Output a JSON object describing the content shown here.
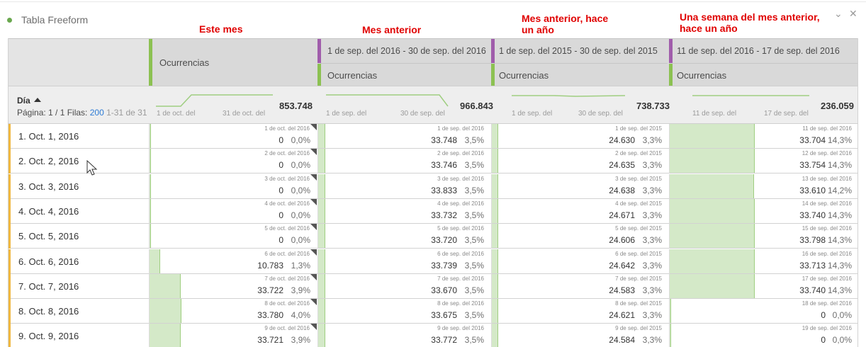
{
  "panel": {
    "title": "Tabla Freeform",
    "collapse_icon": "chevron-down-icon",
    "close_icon": "close-icon"
  },
  "annotations": [
    "Este mes",
    "Mes anterior",
    "Mes anterior, hace\nun año",
    "Una semana del mes anterior,\nhace un año"
  ],
  "header": {
    "col1_metric": "Ocurrencias",
    "col2_range": "1 de sep. del 2016 - 30 de sep. del 2016",
    "col2_metric": "Ocurrencias",
    "col3_range": "1 de sep. del 2015 - 30 de sep. del 2015",
    "col3_metric": "Ocurrencias",
    "col4_range": "11 de sep. del 2016 - 17 de sep. del 2016",
    "col4_metric": "Ocurrencias"
  },
  "summary": {
    "dimension": "Día",
    "pager_prefix": "Página: 1 / 1  Filas:",
    "rows_per_page": "200",
    "range": "1-31 de 31",
    "cols": [
      {
        "total": "853.748",
        "start": "1 de oct. del",
        "end": "31 de oct. del"
      },
      {
        "total": "966.843",
        "start": "1 de sep. del",
        "end": "30 de sep. del"
      },
      {
        "total": "738.733",
        "start": "1 de sep. del",
        "end": "30 de sep. del"
      },
      {
        "total": "236.059",
        "start": "11 de sep. del",
        "end": "17 de sep. del"
      }
    ]
  },
  "rows": [
    {
      "label": "1.   Oct. 1, 2016",
      "cells": [
        {
          "date": "1 de oct. del 2016",
          "val": "0",
          "pct": "0,0%",
          "share": 0.0
        },
        {
          "date": "1 de sep. del 2016",
          "val": "33.748",
          "pct": "3,5%",
          "share": 0.035
        },
        {
          "date": "1 de sep. del 2015",
          "val": "24.630",
          "pct": "3,3%",
          "share": 0.033
        },
        {
          "date": "11 de sep. del 2016",
          "val": "33.704",
          "pct": "14,3%",
          "share": 0.143
        }
      ]
    },
    {
      "label": "2.   Oct. 2, 2016",
      "cells": [
        {
          "date": "2 de oct. del 2016",
          "val": "0",
          "pct": "0,0%",
          "share": 0.0
        },
        {
          "date": "2 de sep. del 2016",
          "val": "33.746",
          "pct": "3,5%",
          "share": 0.035
        },
        {
          "date": "2 de sep. del 2015",
          "val": "24.635",
          "pct": "3,3%",
          "share": 0.033
        },
        {
          "date": "12 de sep. del 2016",
          "val": "33.754",
          "pct": "14,3%",
          "share": 0.143
        }
      ]
    },
    {
      "label": "3.   Oct. 3, 2016",
      "cells": [
        {
          "date": "3 de oct. del 2016",
          "val": "0",
          "pct": "0,0%",
          "share": 0.0
        },
        {
          "date": "3 de sep. del 2016",
          "val": "33.833",
          "pct": "3,5%",
          "share": 0.035
        },
        {
          "date": "3 de sep. del 2015",
          "val": "24.638",
          "pct": "3,3%",
          "share": 0.033
        },
        {
          "date": "13 de sep. del 2016",
          "val": "33.610",
          "pct": "14,2%",
          "share": 0.142
        }
      ]
    },
    {
      "label": "4.   Oct. 4, 2016",
      "cells": [
        {
          "date": "4 de oct. del 2016",
          "val": "0",
          "pct": "0,0%",
          "share": 0.0
        },
        {
          "date": "4 de sep. del 2016",
          "val": "33.732",
          "pct": "3,5%",
          "share": 0.035
        },
        {
          "date": "4 de sep. del 2015",
          "val": "24.671",
          "pct": "3,3%",
          "share": 0.033
        },
        {
          "date": "14 de sep. del 2016",
          "val": "33.740",
          "pct": "14,3%",
          "share": 0.143
        }
      ]
    },
    {
      "label": "5.   Oct. 5, 2016",
      "cells": [
        {
          "date": "5 de oct. del 2016",
          "val": "0",
          "pct": "0,0%",
          "share": 0.0
        },
        {
          "date": "5 de sep. del 2016",
          "val": "33.720",
          "pct": "3,5%",
          "share": 0.035
        },
        {
          "date": "5 de sep. del 2015",
          "val": "24.606",
          "pct": "3,3%",
          "share": 0.033
        },
        {
          "date": "15 de sep. del 2016",
          "val": "33.798",
          "pct": "14,3%",
          "share": 0.143
        }
      ]
    },
    {
      "label": "6.   Oct. 6, 2016",
      "cells": [
        {
          "date": "6 de oct. del 2016",
          "val": "10.783",
          "pct": "1,3%",
          "share": 0.013
        },
        {
          "date": "6 de sep. del 2016",
          "val": "33.739",
          "pct": "3,5%",
          "share": 0.035
        },
        {
          "date": "6 de sep. del 2015",
          "val": "24.642",
          "pct": "3,3%",
          "share": 0.033
        },
        {
          "date": "16 de sep. del 2016",
          "val": "33.713",
          "pct": "14,3%",
          "share": 0.143
        }
      ]
    },
    {
      "label": "7.   Oct. 7, 2016",
      "cells": [
        {
          "date": "7 de oct. del 2016",
          "val": "33.722",
          "pct": "3,9%",
          "share": 0.039
        },
        {
          "date": "7 de sep. del 2016",
          "val": "33.670",
          "pct": "3,5%",
          "share": 0.035
        },
        {
          "date": "7 de sep. del 2015",
          "val": "24.583",
          "pct": "3,3%",
          "share": 0.033
        },
        {
          "date": "17 de sep. del 2016",
          "val": "33.740",
          "pct": "14,3%",
          "share": 0.143
        }
      ]
    },
    {
      "label": "8.   Oct. 8, 2016",
      "cells": [
        {
          "date": "8 de oct. del 2016",
          "val": "33.780",
          "pct": "4,0%",
          "share": 0.04
        },
        {
          "date": "8 de sep. del 2016",
          "val": "33.675",
          "pct": "3,5%",
          "share": 0.035
        },
        {
          "date": "8 de sep. del 2015",
          "val": "24.621",
          "pct": "3,3%",
          "share": 0.033
        },
        {
          "date": "18 de sep. del 2016",
          "val": "0",
          "pct": "0,0%",
          "share": 0.0
        }
      ]
    },
    {
      "label": "9.   Oct. 9, 2016",
      "cells": [
        {
          "date": "9 de oct. del 2016",
          "val": "33.721",
          "pct": "3,9%",
          "share": 0.039
        },
        {
          "date": "9 de sep. del 2016",
          "val": "33.772",
          "pct": "3,5%",
          "share": 0.035
        },
        {
          "date": "9 de sep. del 2015",
          "val": "24.584",
          "pct": "3,3%",
          "share": 0.033
        },
        {
          "date": "19 de sep. del 2016",
          "val": "0",
          "pct": "0,0%",
          "share": 0.0
        }
      ]
    }
  ]
}
